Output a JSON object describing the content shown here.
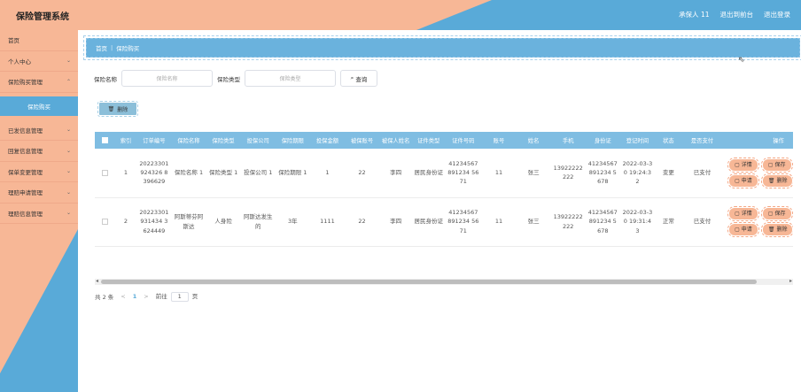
{
  "header": {
    "title": "保险管理系统",
    "user_label": "承保人 11",
    "back_label": "退出到前台",
    "logout_label": "退出登录"
  },
  "sidebar": {
    "items": [
      {
        "label": "首页",
        "chevron": ""
      },
      {
        "label": "个人中心",
        "chevron": "⌄"
      },
      {
        "label": "保险购买管理",
        "chevron": "⌃"
      },
      {
        "label": "已发信息管理",
        "chevron": "⌄"
      },
      {
        "label": "回复信息管理",
        "chevron": "⌄"
      },
      {
        "label": "保单变更管理",
        "chevron": "⌄"
      },
      {
        "label": "理赔申请管理",
        "chevron": "⌄"
      },
      {
        "label": "理赔信息管理",
        "chevron": "⌄"
      }
    ],
    "sub_item": "保险购买"
  },
  "breadcrumb": {
    "home": "首页",
    "sep": "|",
    "current": "保险购买"
  },
  "search": {
    "name_label": "保险名称",
    "name_placeholder": "保险名称",
    "type_label": "保险类型",
    "type_placeholder": "保险类型",
    "button": "查询"
  },
  "toolbar": {
    "delete_label": "删除"
  },
  "table": {
    "headers": [
      "索引",
      "订单编号",
      "保险名称",
      "保险类型",
      "投保公司",
      "保险期限",
      "投保金额",
      "被保账号",
      "被保人姓名",
      "证件类型",
      "证件号码",
      "账号",
      "姓名",
      "手机",
      "身份证",
      "登记时间",
      "状态",
      "是否支付",
      "操作"
    ],
    "rows": [
      {
        "index": "1",
        "order_no": "20223301924326 8396629",
        "name": "保险名称 1",
        "type": "保险类型 1",
        "company": "投保公司 1",
        "period": "保险期限 1",
        "amount": "1",
        "insured_account": "22",
        "insured_name": "李四",
        "id_type": "居民身份证",
        "id_number": "41234567891234 5671",
        "account": "11",
        "user_name": "张三",
        "phone": "13922222222",
        "id_card": "41234567891234 5678",
        "reg_time": "2022-03-30 19:24:32",
        "status": "变更",
        "paid": "已支付"
      },
      {
        "index": "2",
        "order_no": "20223301931434 3624449",
        "name": "阿斯蒂芬阿斯达",
        "type": "人身险",
        "company": "阿斯达发生的",
        "period": "3年",
        "amount": "1111",
        "insured_account": "22",
        "insured_name": "李四",
        "id_type": "居民身份证",
        "id_number": "41234567891234 5671",
        "account": "11",
        "user_name": "张三",
        "phone": "13922222222",
        "id_card": "41234567891234 5678",
        "reg_time": "2022-03-30 19:31:43",
        "status": "正常",
        "paid": "已支付"
      }
    ],
    "actions": {
      "detail": "详情",
      "save": "保存",
      "apply": "申请",
      "delete": "删除"
    }
  },
  "pagination": {
    "total": "共 2 条",
    "prev": "<",
    "current": "1",
    "next": ">",
    "goto_label": "前往",
    "goto_value": "1",
    "page_label": "页"
  },
  "colors": {
    "peach": "#f7b796",
    "blue": "#59aad8",
    "header_row": "#7fbde2"
  }
}
